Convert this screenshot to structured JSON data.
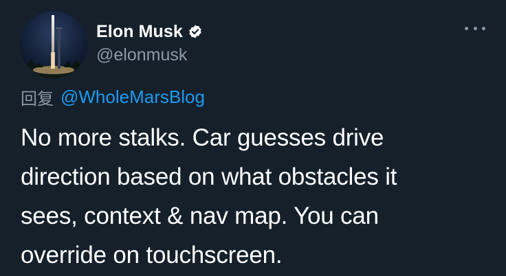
{
  "author": {
    "display_name": "Elon Musk",
    "handle": "@elonmusk",
    "verified": true
  },
  "reply": {
    "prefix": "回复",
    "mention": "@WholeMarsBlog"
  },
  "tweet": {
    "text": "No more stalks. Car guesses drive\ndirection based on what obstacles it\nsees, context & nav map. You can\noverride on touchscreen."
  },
  "icons": {
    "verified": "verified-badge-icon",
    "more": "more-options-icon"
  },
  "colors": {
    "background": "#15202b",
    "text": "#ffffff",
    "secondary_text": "#8b98a5",
    "link": "#1d9bf0"
  }
}
